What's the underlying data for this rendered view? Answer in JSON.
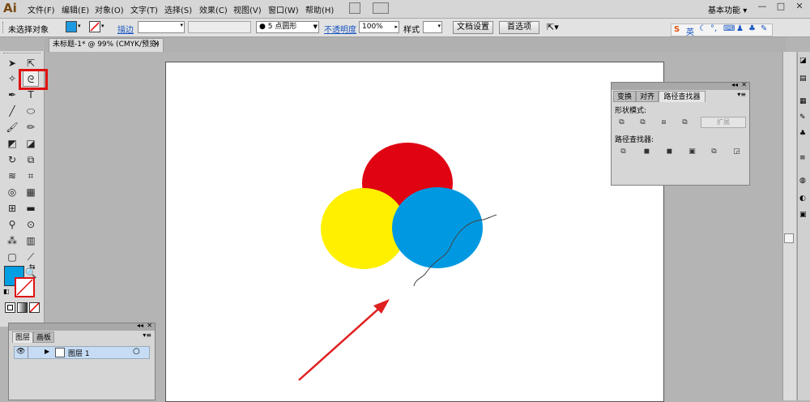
{
  "app": {
    "logo": "Ai"
  },
  "menubar": {
    "items": [
      "文件(F)",
      "编辑(E)",
      "对象(O)",
      "文字(T)",
      "选择(S)",
      "效果(C)",
      "视图(V)",
      "窗口(W)",
      "帮助(H)"
    ],
    "workspace_label": "基本功能",
    "workspace_arrow": "▾",
    "window_buttons": [
      "—",
      "□",
      "✕"
    ]
  },
  "controlbar": {
    "selection_status": "未选择对象",
    "fill_color": "#1e9be0",
    "stroke_label": "描边",
    "brush_value": "5 点圆形",
    "opacity_label": "不透明度",
    "opacity_value": "100%",
    "style_label": "样式",
    "doc_setup_button": "文档设置",
    "preferences_button": "首选项"
  },
  "ime": {
    "logo": "S",
    "lang": "英"
  },
  "document": {
    "tab_title": "未标题-1* @ 99% (CMYK/预览)"
  },
  "toolbar": {
    "fill_color": "#009ee2",
    "stroke_color": "#ffffff"
  },
  "canvas": {
    "circles": [
      {
        "name": "red",
        "color": "#e00412"
      },
      {
        "name": "yellow",
        "color": "#fff000"
      },
      {
        "name": "blue",
        "color": "#0099e1"
      }
    ],
    "arrow_color": "#e02020"
  },
  "pathfinder_panel": {
    "tabs": [
      "变换",
      "对齐",
      "路径查找器"
    ],
    "shape_modes_label": "形状模式:",
    "expand_button": "扩展",
    "pathfinders_label": "路径查找器:"
  },
  "layers_panel": {
    "tabs": [
      "图层",
      "画板"
    ],
    "layer_name": "图层 1"
  }
}
